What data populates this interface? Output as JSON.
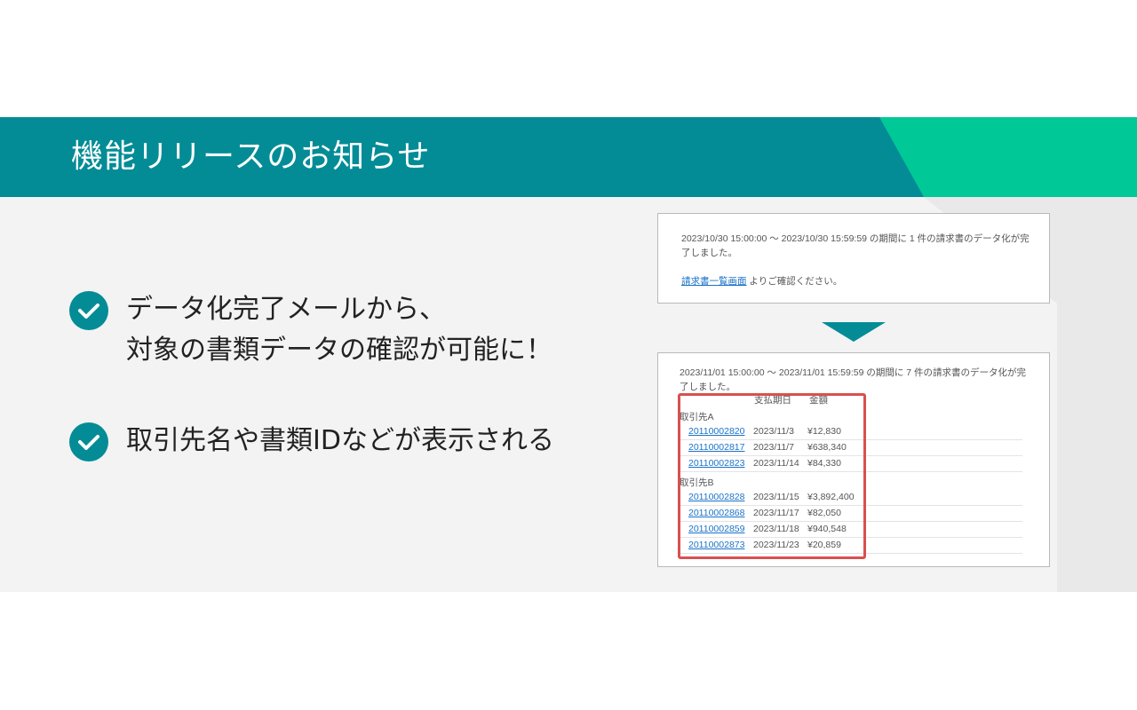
{
  "header": {
    "title": "機能リリースのお知らせ",
    "band_color": "#038c96",
    "accent_color": "#00c896"
  },
  "features": [
    {
      "lines": [
        "データ化完了メールから、",
        "対象の書類データの確認が可能に！"
      ],
      "icon": "check-circle-icon"
    },
    {
      "lines": [
        "取引先名や書類IDなどが表示される"
      ],
      "icon": "check-circle-icon"
    }
  ],
  "before_email": {
    "message": "2023/10/30 15:00:00 〜 2023/10/30 15:59:59 の期間に 1 件の請求書のデータ化が完了しました。",
    "link_text": "請求書一覧画面",
    "link_suffix": " よりご確認ください。"
  },
  "after_email": {
    "message": "2023/11/01 15:00:00 〜 2023/11/01 15:59:59 の期間に 7 件の請求書のデータ化が完了しました。",
    "columns": [
      "支払期日",
      "金額"
    ],
    "groups": [
      {
        "name": "取引先A",
        "rows": [
          {
            "id": "20110002820",
            "date": "2023/11/3",
            "amount": "¥12,830"
          },
          {
            "id": "20110002817",
            "date": "2023/11/7",
            "amount": "¥638,340"
          },
          {
            "id": "20110002823",
            "date": "2023/11/14",
            "amount": "¥84,330"
          }
        ]
      },
      {
        "name": "取引先B",
        "rows": [
          {
            "id": "20110002828",
            "date": "2023/11/15",
            "amount": "¥3,892,400"
          },
          {
            "id": "20110002868",
            "date": "2023/11/17",
            "amount": "¥82,050"
          },
          {
            "id": "20110002859",
            "date": "2023/11/18",
            "amount": "¥940,548"
          },
          {
            "id": "20110002873",
            "date": "2023/11/23",
            "amount": "¥20,859"
          }
        ]
      }
    ],
    "highlight_color": "#d95050",
    "link_color": "#1a73c8"
  }
}
